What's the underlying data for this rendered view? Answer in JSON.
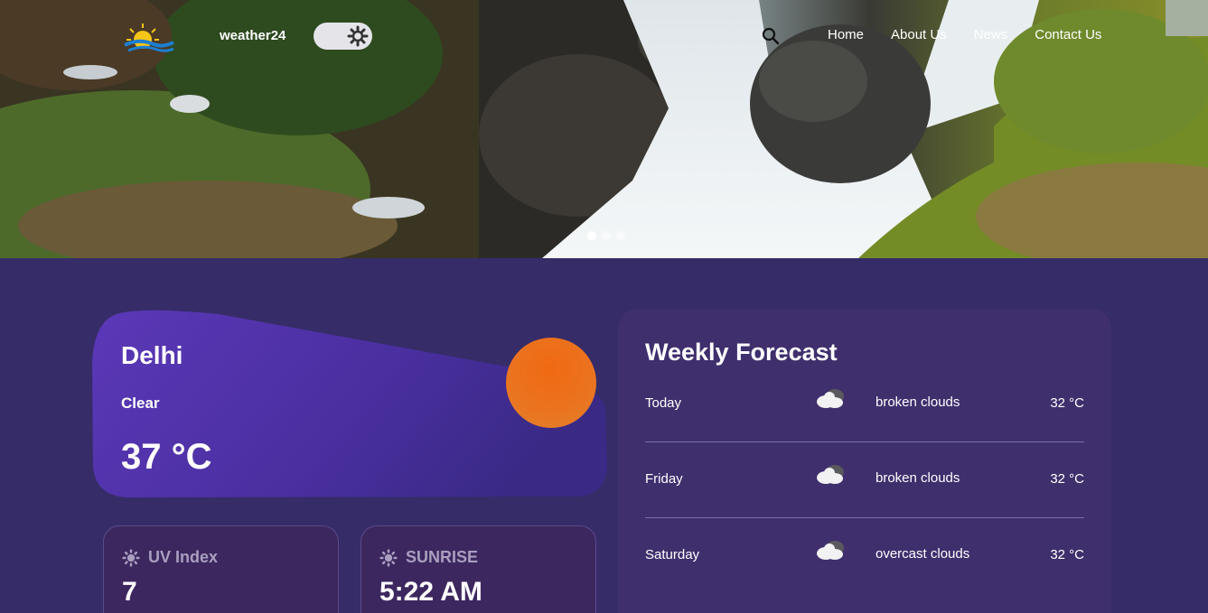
{
  "header": {
    "brand": "weather24",
    "nav": [
      "Home",
      "About Us",
      "News",
      "Contact Us"
    ]
  },
  "hero": {
    "slides": 3,
    "active_slide": 1
  },
  "current": {
    "city": "Delhi",
    "condition": "Clear",
    "temperature": "37 °C"
  },
  "cards": [
    {
      "label": "UV Index",
      "value": "7"
    },
    {
      "label": "SUNRISE",
      "value": "5:22 AM"
    }
  ],
  "forecast": {
    "title": "Weekly Forecast",
    "days": [
      {
        "day": "Today",
        "desc": "broken clouds",
        "temp": "32 °C",
        "icon": "cloud-icon"
      },
      {
        "day": "Friday",
        "desc": "broken clouds",
        "temp": "32 °C",
        "icon": "cloud-icon"
      },
      {
        "day": "Saturday",
        "desc": "overcast clouds",
        "temp": "32 °C",
        "icon": "cloud-icon"
      }
    ]
  },
  "colors": {
    "page_bg": "#362c68",
    "card_gradient_start": "#5b38b8",
    "card_gradient_end": "#3a2a86",
    "sun": "#f16912",
    "forecast_bg": "#3f2f6d"
  }
}
